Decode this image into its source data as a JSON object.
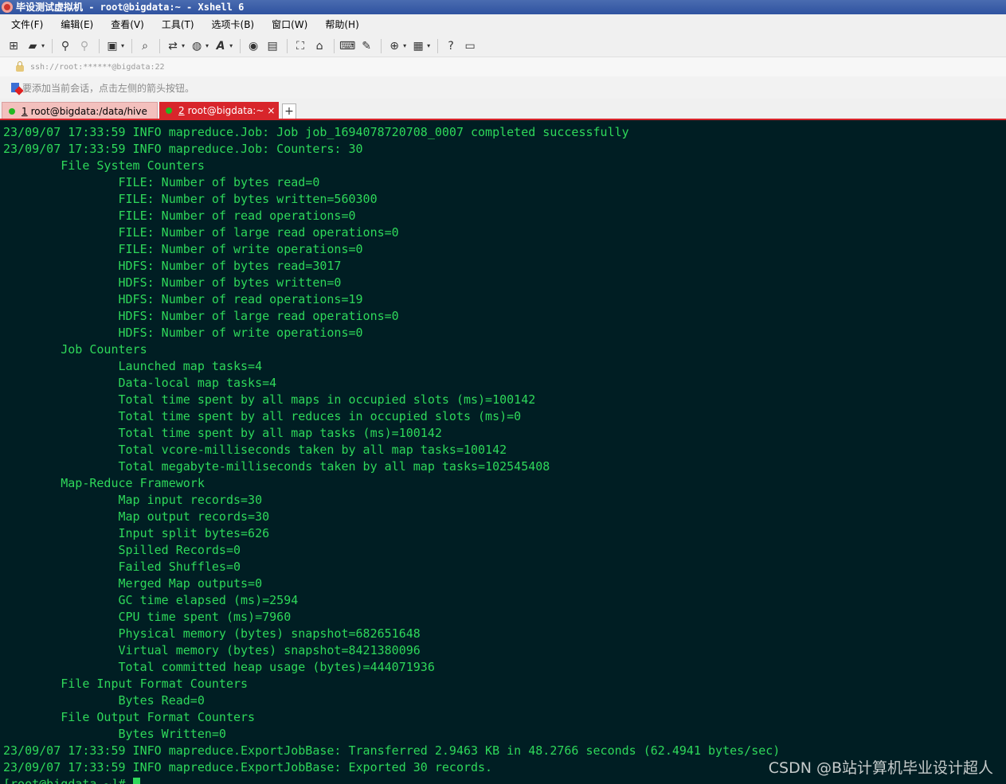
{
  "window": {
    "title": "毕设测试虚拟机 - root@bigdata:~ - Xshell 6"
  },
  "menu": [
    {
      "label": "文件(F)"
    },
    {
      "label": "编辑(E)"
    },
    {
      "label": "查看(V)"
    },
    {
      "label": "工具(T)"
    },
    {
      "label": "选项卡(B)"
    },
    {
      "label": "窗口(W)"
    },
    {
      "label": "帮助(H)"
    }
  ],
  "toolbar": {
    "icons": [
      "new-session-icon",
      "open-folder-icon",
      "reconnect-icon",
      "disconnect-icon",
      "session-properties-icon",
      "find-icon",
      "transfer-icon",
      "globe-icon",
      "font-icon",
      "xftp-icon",
      "screenshot-icon",
      "fullscreen-icon",
      "lock-icon",
      "keyboard-icon",
      "compose-icon",
      "add-tab-icon",
      "layout-icon",
      "help-icon",
      "chat-icon"
    ]
  },
  "address": {
    "text": "ssh://root:******@bigdata:22"
  },
  "session_hint": {
    "text": "要添加当前会话，点击左侧的箭头按钮。"
  },
  "tabs": [
    {
      "num": "1",
      "label": "root@bigdata:/data/hive",
      "active": false
    },
    {
      "num": "2",
      "label": "root@bigdata:~",
      "active": true
    }
  ],
  "tab_close": "×",
  "tab_add": "+",
  "terminal": {
    "lines": [
      "23/09/07 17:33:59 INFO mapreduce.Job: Job job_1694078720708_0007 completed successfully",
      "23/09/07 17:33:59 INFO mapreduce.Job: Counters: 30",
      "        File System Counters",
      "                FILE: Number of bytes read=0",
      "                FILE: Number of bytes written=560300",
      "                FILE: Number of read operations=0",
      "                FILE: Number of large read operations=0",
      "                FILE: Number of write operations=0",
      "                HDFS: Number of bytes read=3017",
      "                HDFS: Number of bytes written=0",
      "                HDFS: Number of read operations=19",
      "                HDFS: Number of large read operations=0",
      "                HDFS: Number of write operations=0",
      "        Job Counters",
      "                Launched map tasks=4",
      "                Data-local map tasks=4",
      "                Total time spent by all maps in occupied slots (ms)=100142",
      "                Total time spent by all reduces in occupied slots (ms)=0",
      "                Total time spent by all map tasks (ms)=100142",
      "                Total vcore-milliseconds taken by all map tasks=100142",
      "                Total megabyte-milliseconds taken by all map tasks=102545408",
      "        Map-Reduce Framework",
      "                Map input records=30",
      "                Map output records=30",
      "                Input split bytes=626",
      "                Spilled Records=0",
      "                Failed Shuffles=0",
      "                Merged Map outputs=0",
      "                GC time elapsed (ms)=2594",
      "                CPU time spent (ms)=7960",
      "                Physical memory (bytes) snapshot=682651648",
      "                Virtual memory (bytes) snapshot=8421380096",
      "                Total committed heap usage (bytes)=444071936",
      "        File Input Format Counters",
      "                Bytes Read=0",
      "        File Output Format Counters",
      "                Bytes Written=0",
      "23/09/07 17:33:59 INFO mapreduce.ExportJobBase: Transferred 2.9463 KB in 48.2766 seconds (62.4941 bytes/sec)",
      "23/09/07 17:33:59 INFO mapreduce.ExportJobBase: Exported 30 records."
    ],
    "prompt": "[root@bigdata ~]# "
  },
  "watermark": {
    "text": "CSDN @B站计算机毕业设计超人"
  },
  "colors": {
    "terminal_bg": "#001e23",
    "terminal_fg": "#2ed85a",
    "active_tab": "#d8252b",
    "inactive_tab": "#f3c0bd"
  }
}
